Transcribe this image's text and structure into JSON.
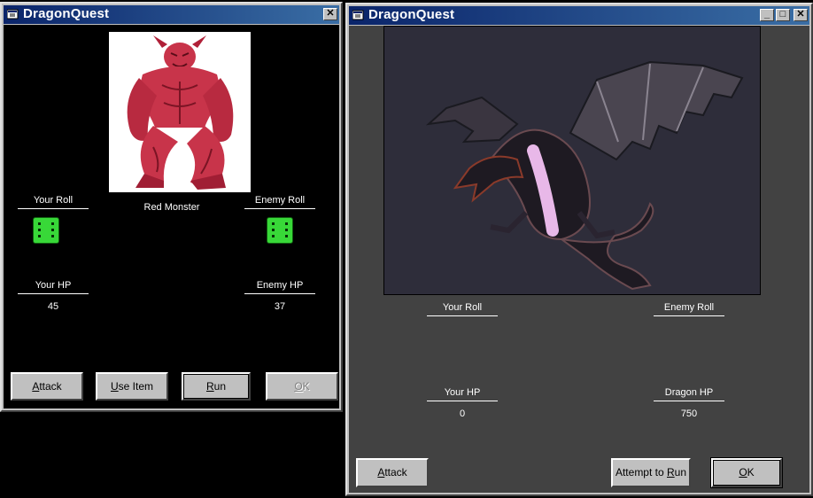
{
  "window_left": {
    "title": "DragonQuest",
    "monster_name": "Red Monster",
    "your_roll_label": "Your Roll",
    "enemy_roll_label": "Enemy Roll",
    "your_hp_label": "Your HP",
    "enemy_hp_label": "Enemy HP",
    "your_hp": "45",
    "enemy_hp": "37",
    "buttons": {
      "attack": {
        "prefix": "",
        "accel": "A",
        "rest": "ttack"
      },
      "use_item": {
        "prefix": "",
        "accel": "U",
        "rest": "se Item"
      },
      "run": {
        "prefix": "",
        "accel": "R",
        "rest": "un"
      },
      "ok": {
        "prefix": "",
        "accel": "O",
        "rest": "K"
      }
    },
    "colors": {
      "background": "#000000",
      "monster": "#c8344a",
      "die": "#38d838"
    }
  },
  "window_right": {
    "title": "DragonQuest",
    "your_roll_label": "Your Roll",
    "enemy_roll_label": "Enemy Roll",
    "your_hp_label": "Your HP",
    "dragon_hp_label": "Dragon HP",
    "your_hp": "0",
    "dragon_hp": "750",
    "buttons": {
      "attack": {
        "prefix": "",
        "accel": "A",
        "rest": "ttack"
      },
      "attempt_to_run": {
        "prefix": "Attempt to ",
        "accel": "R",
        "rest": "un"
      },
      "ok": {
        "prefix": "",
        "accel": "O",
        "rest": "K"
      }
    },
    "colors": {
      "background": "#424242",
      "image_bg": "#2e2d3a"
    }
  },
  "icons": [
    "app-icon",
    "close-icon",
    "minimize-icon",
    "maximize-icon",
    "die-icon"
  ]
}
